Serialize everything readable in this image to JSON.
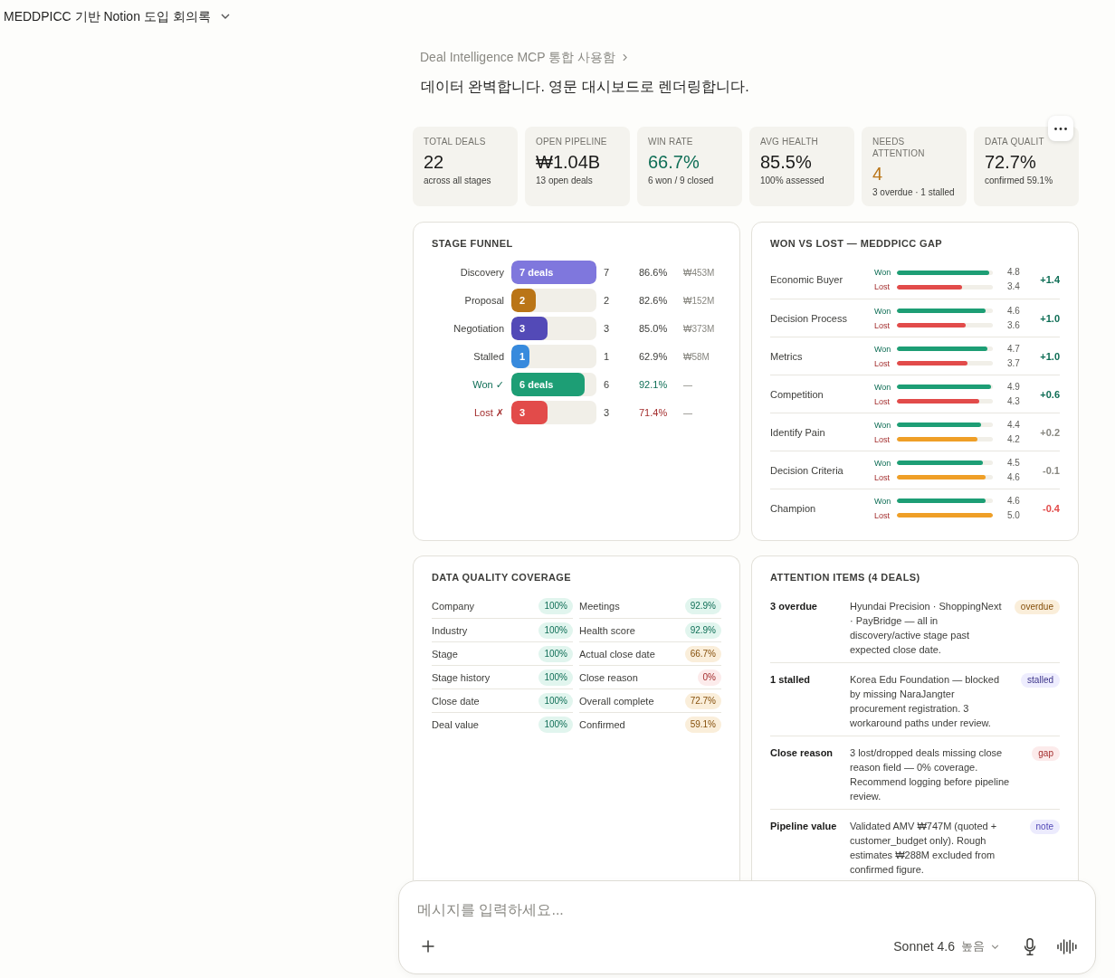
{
  "header": {
    "title": "MEDDPICC 기반 Notion 도입 회의록"
  },
  "message": {
    "tool_note": "Deal Intelligence MCP 통합 사용함",
    "text": "데이터 완벽합니다. 영문 대시보드로 렌더링합니다."
  },
  "kpis": [
    {
      "label": "TOTAL DEALS",
      "value": "22",
      "sub": "across all stages",
      "color": "#1a1a19"
    },
    {
      "label": "OPEN PIPELINE",
      "value": "₩1.04B",
      "sub": "13 open deals",
      "color": "#1a1a19"
    },
    {
      "label": "WIN RATE",
      "value": "66.7%",
      "sub": "6 won / 9 closed",
      "color": "#0f6e56"
    },
    {
      "label": "AVG HEALTH",
      "value": "85.5%",
      "sub": "100% assessed",
      "color": "#1a1a19"
    },
    {
      "label": "NEEDS ATTENTION",
      "value": "4",
      "sub": "3 overdue · 1 stalled",
      "color": "#ba7517"
    },
    {
      "label": "DATA QUALIT",
      "value": "72.7%",
      "sub": "confirmed 59.1%",
      "color": "#1a1a19"
    }
  ],
  "funnel": {
    "title": "STAGE FUNNEL",
    "rows": [
      {
        "label": "Discovery",
        "kind": "open",
        "bar_text": "7 deals",
        "level": 1,
        "color": "#7f77dd",
        "count": "7",
        "percent": "86.6%",
        "amount": "₩453M"
      },
      {
        "label": "Proposal",
        "kind": "open",
        "bar_text": "2",
        "level": 0.29,
        "color": "#ba7517",
        "count": "2",
        "percent": "82.6%",
        "amount": "₩152M"
      },
      {
        "label": "Negotiation",
        "kind": "open",
        "bar_text": "3",
        "level": 0.43,
        "color": "#534ab7",
        "count": "3",
        "percent": "85.0%",
        "amount": "₩373M"
      },
      {
        "label": "Stalled",
        "kind": "open",
        "bar_text": "1",
        "level": 0.21,
        "color": "#378add",
        "count": "1",
        "percent": "62.9%",
        "amount": "₩58M"
      },
      {
        "label": "Won ✓",
        "kind": "won",
        "bar_text": "6 deals",
        "level": 0.86,
        "color": "#1d9e75",
        "count": "6",
        "percent": "92.1%",
        "amount": "—"
      },
      {
        "label": "Lost ✗",
        "kind": "lost",
        "bar_text": "3",
        "level": 0.43,
        "color": "#e24b4a",
        "count": "3",
        "percent": "71.4%",
        "amount": "—"
      }
    ]
  },
  "gap": {
    "title": "WON VS LOST — MEDDPICC GAP",
    "rows": [
      {
        "label": "Economic Buyer",
        "won": {
          "label": "Won",
          "value": "4.8",
          "level": 0.96
        },
        "lost": {
          "label": "Lost",
          "value": "3.4",
          "level": 0.68,
          "color": "#e24b4a"
        },
        "delta": {
          "text": "+1.4",
          "color": "#0f6e56"
        }
      },
      {
        "label": "Decision Process",
        "won": {
          "label": "Won",
          "value": "4.6",
          "level": 0.92
        },
        "lost": {
          "label": "Lost",
          "value": "3.6",
          "level": 0.72,
          "color": "#e24b4a"
        },
        "delta": {
          "text": "+1.0",
          "color": "#0f6e56"
        }
      },
      {
        "label": "Metrics",
        "won": {
          "label": "Won",
          "value": "4.7",
          "level": 0.94
        },
        "lost": {
          "label": "Lost",
          "value": "3.7",
          "level": 0.74,
          "color": "#e24b4a"
        },
        "delta": {
          "text": "+1.0",
          "color": "#0f6e56"
        }
      },
      {
        "label": "Competition",
        "won": {
          "label": "Won",
          "value": "4.9",
          "level": 0.98
        },
        "lost": {
          "label": "Lost",
          "value": "4.3",
          "level": 0.86,
          "color": "#e24b4a"
        },
        "delta": {
          "text": "+0.6",
          "color": "#0f6e56"
        }
      },
      {
        "label": "Identify Pain",
        "won": {
          "label": "Won",
          "value": "4.4",
          "level": 0.88
        },
        "lost": {
          "label": "Lost",
          "value": "4.2",
          "level": 0.84,
          "color": "#ef9f27"
        },
        "delta": {
          "text": "+0.2",
          "color": "#888780"
        }
      },
      {
        "label": "Decision Criteria",
        "won": {
          "label": "Won",
          "value": "4.5",
          "level": 0.9
        },
        "lost": {
          "label": "Lost",
          "value": "4.6",
          "level": 0.92,
          "color": "#ef9f27"
        },
        "delta": {
          "text": "-0.1",
          "color": "#888780"
        }
      },
      {
        "label": "Champion",
        "won": {
          "label": "Won",
          "value": "4.6",
          "level": 0.92
        },
        "lost": {
          "label": "Lost",
          "value": "5.0",
          "level": 1,
          "color": "#ef9f27"
        },
        "delta": {
          "text": "-0.4",
          "color": "#e24b4a"
        }
      }
    ]
  },
  "coverage": {
    "title": "DATA QUALITY COVERAGE",
    "columns": [
      [
        {
          "label": "Company",
          "value": "100%",
          "kind": "full"
        },
        {
          "label": "Industry",
          "value": "100%",
          "kind": "full"
        },
        {
          "label": "Stage",
          "value": "100%",
          "kind": "full"
        },
        {
          "label": "Stage history",
          "value": "100%",
          "kind": "full"
        },
        {
          "label": "Close date",
          "value": "100%",
          "kind": "full"
        },
        {
          "label": "Deal value",
          "value": "100%",
          "kind": "full"
        }
      ],
      [
        {
          "label": "Meetings",
          "value": "92.9%",
          "kind": "full"
        },
        {
          "label": "Health score",
          "value": "92.9%",
          "kind": "full"
        },
        {
          "label": "Actual close date",
          "value": "66.7%",
          "kind": "partial"
        },
        {
          "label": "Close reason",
          "value": "0%",
          "kind": "empty"
        },
        {
          "label": "Overall complete",
          "value": "72.7%",
          "kind": "partial"
        },
        {
          "label": "Confirmed",
          "value": "59.1%",
          "kind": "partial"
        }
      ]
    ]
  },
  "attention": {
    "title": "ATTENTION ITEMS (4 DEALS)",
    "items": [
      {
        "label": "3 overdue",
        "text": "Hyundai Precision · ShoppingNext · PayBridge — all in discovery/active stage past expected close date.",
        "tag": "overdue",
        "kind": "warning"
      },
      {
        "label": "1 stalled",
        "text": "Korea Edu Foundation — blocked by missing NaraJangter procurement registration. 3 workaround paths under review.",
        "tag": "stalled",
        "kind": "blocked"
      },
      {
        "label": "Close reason",
        "text": "3 lost/dropped deals missing close reason field — 0% coverage. Recommend logging before pipeline review.",
        "tag": "gap",
        "kind": "missing"
      },
      {
        "label": "Pipeline value",
        "text": "Validated AMV ₩747M (quoted + customer_budget only). Rough estimates ₩288M excluded from confirmed figure.",
        "tag": "note",
        "kind": "info"
      }
    ]
  },
  "composer": {
    "placeholder": "메시지를 입력하세요...",
    "model": "Sonnet 4.6",
    "effort": "높음"
  }
}
